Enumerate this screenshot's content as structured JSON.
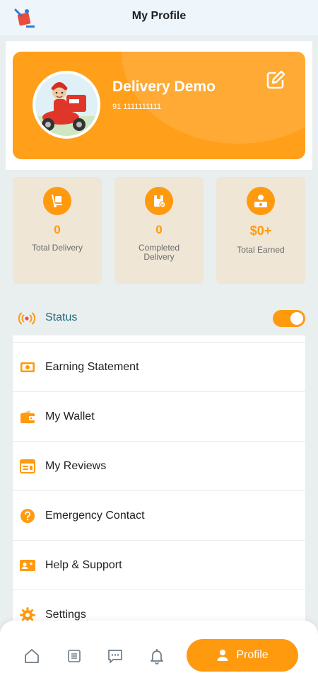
{
  "header": {
    "title": "My Profile"
  },
  "profile": {
    "name": "Delivery Demo",
    "phone": "91 1111111111"
  },
  "stats": [
    {
      "value": "0",
      "label": "Total Delivery",
      "icon": "hand-truck-icon"
    },
    {
      "value": "0",
      "label_line1": "Completed",
      "label_line2": "Delivery",
      "icon": "completed-box-icon"
    },
    {
      "value": "$0+",
      "label": "Total Earned",
      "icon": "money-bag-icon"
    }
  ],
  "status": {
    "label": "Status",
    "enabled": true
  },
  "menu": [
    {
      "label": "Earning Statement",
      "icon": "cash-icon"
    },
    {
      "label": "My Wallet",
      "icon": "wallet-icon"
    },
    {
      "label": "My Reviews",
      "icon": "reviews-icon"
    },
    {
      "label": "Emergency Contact",
      "icon": "question-icon"
    },
    {
      "label": "Help & Support",
      "icon": "support-icon"
    },
    {
      "label": "Settings",
      "icon": "settings-icon"
    }
  ],
  "bottom_nav": {
    "items": [
      "home-icon",
      "orders-icon",
      "chat-icon",
      "bell-icon"
    ],
    "active_label": "Profile"
  },
  "colors": {
    "accent": "#ff9a0f",
    "stat_bg": "#efe6d6",
    "status_text": "#1f6b7a"
  }
}
